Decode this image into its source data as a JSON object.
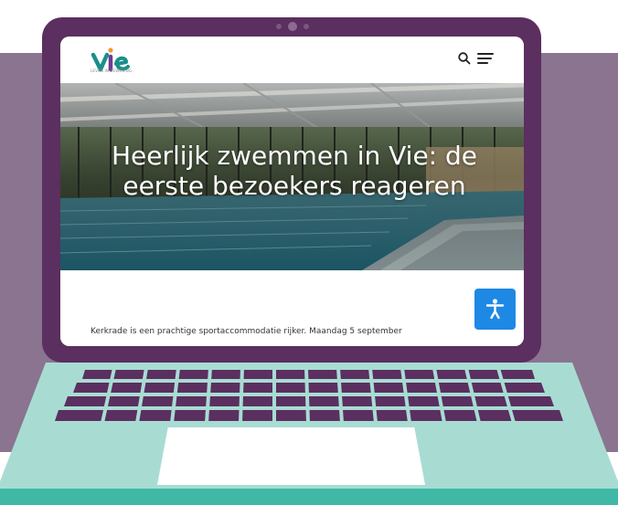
{
  "site": {
    "logo_text": "vie",
    "logo_tagline": "LEVEN IN BEWEGING",
    "search_icon": "search-icon",
    "menu_icon": "hamburger-menu-icon"
  },
  "hero": {
    "title_line1": "Heerlijk zwemmen in Vie: de",
    "title_line2": "eerste bezoekers reageren"
  },
  "article": {
    "intro": "Kerkrade is een prachtige sportaccommodatie rijker. Maandag 5 september"
  },
  "accessibility": {
    "icon": "accessibility-person-icon"
  },
  "colors": {
    "background_band": "#8a7490",
    "laptop_body": "#5b2f5f",
    "laptop_base": "#a8dcd3",
    "keyboard_keys": "#5b2f5f",
    "accessibility_button": "#1e88e5",
    "logo_teal": "#1a8f8a",
    "logo_purple": "#6a3d8e",
    "logo_orange": "#f29a2e"
  }
}
